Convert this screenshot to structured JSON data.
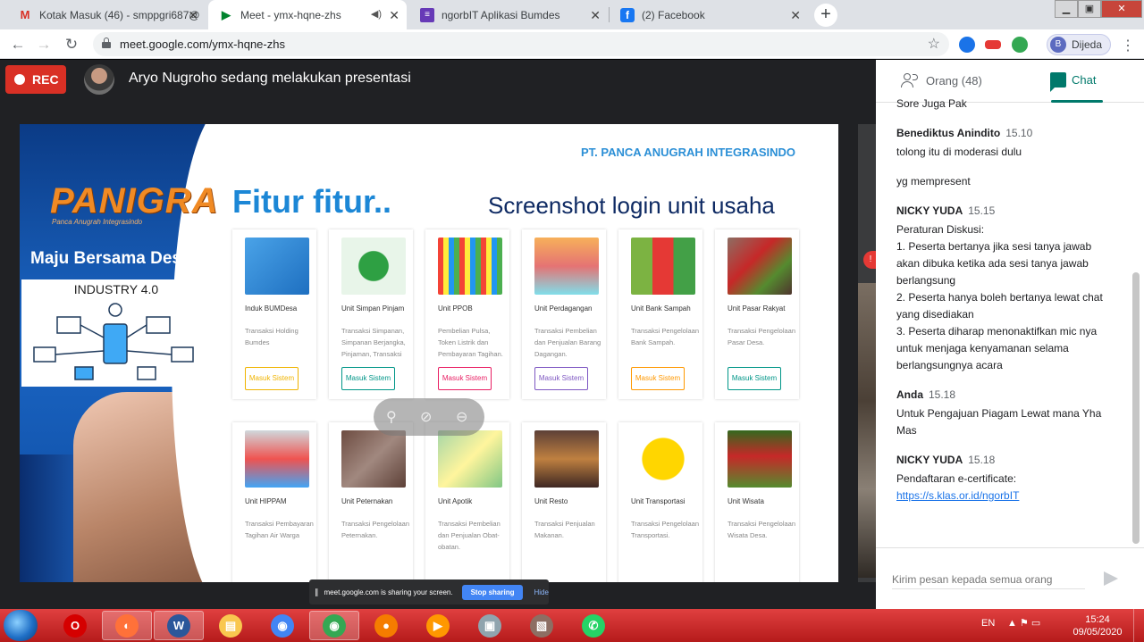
{
  "browser": {
    "tabs": [
      {
        "title": "Kotak Masuk (46) - smppgri687@",
        "icon": "gmail-icon",
        "color": "#d93025",
        "glyph": "M"
      },
      {
        "title": "Meet - ymx-hqne-zhs",
        "icon": "meet-icon",
        "color": "#00832d",
        "glyph": "▶"
      },
      {
        "title": "ngorbIT Aplikasi Bumdes",
        "icon": "form-icon",
        "color": "#673ab7",
        "glyph": "≡"
      },
      {
        "title": "(2) Facebook",
        "icon": "facebook-icon",
        "color": "#1877f2",
        "glyph": "f"
      }
    ],
    "new_tab": "+",
    "url": "meet.google.com/ymx-hqne-zhs",
    "profile_initial": "B",
    "profile_name": "Dijeda"
  },
  "meet": {
    "rec_label": "REC",
    "presenting_text": "Aryo Nugroho sedang melakukan presentasi",
    "sharing_text": "meet.google.com is sharing your screen.",
    "stop_sharing": "Stop sharing",
    "hide": "Hide"
  },
  "slide": {
    "logo": "PANIGRA",
    "logo_sub": "Panca Anugrah Integrasindo",
    "slogan": "Maju Bersama Desa",
    "industry": "INDUSTRY 4.0",
    "company": "PT. PANCA ANUGRAH INTEGRASINDO",
    "title_left": "Fitur fitur..",
    "title_right": "Screenshot  login unit usaha",
    "button_label": "Masuk Sistem",
    "cards": [
      {
        "name": "Induk BUMDesa",
        "desc": "Transaksi Holding Bumdes",
        "btn_color": "#f0b400",
        "img": "linear-gradient(135deg,#4aa3e8,#1e6fc0)"
      },
      {
        "name": "Unit Simpan Pinjam",
        "desc": "Transaksi Simpanan, Simpanan Berjangka, Pinjaman, Transaksi",
        "btn_color": "#009688",
        "img": "radial-gradient(circle,#2ea043 0 34%,#e8f5e9 36%)"
      },
      {
        "name": "Unit PPOB",
        "desc": "Pembelian Pulsa, Token Listrik dan Pembayaran Tagihan.",
        "btn_color": "#e91e63",
        "img": "repeating-linear-gradient(90deg,#f44336 0 6px,#ffeb3b 6px 12px,#2196f3 12px 18px,#4caf50 18px 24px)"
      },
      {
        "name": "Unit Perdagangan",
        "desc": "Transaksi Pembelian dan Penjualan Barang Dagangan.",
        "btn_color": "#7e57c2",
        "img": "linear-gradient(180deg,#f7b05a,#e57373 50%,#80deea)"
      },
      {
        "name": "Unit Bank Sampah",
        "desc": "Transaksi Pengelolaan Bank Sampah.",
        "btn_color": "#ff9800",
        "img": "linear-gradient(90deg,#7cb342 0 33%,#e53935 33% 66%,#43a047 66%)"
      },
      {
        "name": "Unit Pasar Rakyat",
        "desc": "Transaksi Pengelolaan Pasar Desa.",
        "btn_color": "#009688",
        "img": "linear-gradient(135deg,#8d6e63,#c62828 40%,#558b2f 70%,#4e342e)"
      },
      {
        "name": "Unit HIPPAM",
        "desc": "Transaksi Pembayaran Tagihan Air Warga",
        "btn_color": "",
        "img": "linear-gradient(180deg,#cfd8dc,#ef5350 50%,#42a5f5)"
      },
      {
        "name": "Unit Peternakan",
        "desc": "Transaksi Pengelolaan Peternakan.",
        "btn_color": "",
        "img": "linear-gradient(135deg,#6d4c41,#a1887f 50%,#5d4037)"
      },
      {
        "name": "Unit Apotik",
        "desc": "Transaksi Pembelian dan Penjualan Obat-obatan.",
        "btn_color": "",
        "img": "linear-gradient(135deg,#a5d6a7,#fff59d 50%,#81c784)"
      },
      {
        "name": "Unit Resto",
        "desc": "Transaksi Penjualan Makanan.",
        "btn_color": "",
        "img": "linear-gradient(180deg,#5d4037,#bf8040 50%,#3e2723)"
      },
      {
        "name": "Unit Transportasi",
        "desc": "Transaksi Pengelolaan Transportasi.",
        "btn_color": "",
        "img": "radial-gradient(circle,#ffd600 0 48%,#fff 50%)"
      },
      {
        "name": "Unit Wisata",
        "desc": "Transaksi Pengelolaan Wisata Desa.",
        "btn_color": "",
        "img": "linear-gradient(180deg,#33691e,#c62828 45%,#558b2f)"
      }
    ]
  },
  "panel": {
    "people_tab": "Orang (48)",
    "chat_tab": "Chat",
    "messages": [
      {
        "sender": "",
        "time": "",
        "lines": [
          "Sore Juga Pak"
        ]
      },
      {
        "sender": "Benediktus Anindito",
        "time": "15.10",
        "lines": [
          "tolong itu di moderasi dulu"
        ]
      },
      {
        "sender": "",
        "time": "",
        "lines": [
          "yg mempresent"
        ]
      },
      {
        "sender": "NICKY YUDA",
        "time": "15.15",
        "lines": [
          "Peraturan Diskusi:",
          "1. Peserta bertanya jika sesi tanya jawab",
          "akan dibuka ketika ada sesi tanya jawab",
          "berlangsung",
          "2. Peserta hanya boleh bertanya lewat chat",
          "yang disediakan",
          "3. Peserta diharap menonaktifkan mic nya",
          "untuk menjaga kenyamanan selama",
          "berlangsungnya acara"
        ]
      },
      {
        "sender": "Anda",
        "time": "15.18",
        "lines": [
          "Untuk Pengajuan Piagam Lewat mana Yha",
          "Mas"
        ]
      },
      {
        "sender": "NICKY YUDA",
        "time": "15.18",
        "lines": [
          "Pendaftaran e-certificate:"
        ],
        "link": "https://s.klas.or.id/ngorbIT"
      }
    ],
    "compose_placeholder": "Kirim pesan kepada semua orang"
  },
  "taskbar": {
    "apps": [
      {
        "name": "opera-icon",
        "color": "#d50000",
        "glyph": "O",
        "active": false
      },
      {
        "name": "firefox-icon",
        "color": "#ff7139",
        "glyph": "◐",
        "active": true
      },
      {
        "name": "word-icon",
        "color": "#2b579a",
        "glyph": "W",
        "active": true
      },
      {
        "name": "explorer-icon",
        "color": "#f9c74f",
        "glyph": "▤",
        "active": false
      },
      {
        "name": "chrome-icon",
        "color": "#4285f4",
        "glyph": "◉",
        "active": false
      },
      {
        "name": "chrome-profile-icon",
        "color": "#34a853",
        "glyph": "◉",
        "active": true
      },
      {
        "name": "avast-icon",
        "color": "#f57c00",
        "glyph": "●",
        "active": false
      },
      {
        "name": "media-player-icon",
        "color": "#ff9800",
        "glyph": "▶",
        "active": false
      },
      {
        "name": "network-icon",
        "color": "#90a4ae",
        "glyph": "▣",
        "active": false
      },
      {
        "name": "image-viewer-icon",
        "color": "#8d6e63",
        "glyph": "▧",
        "active": false
      },
      {
        "name": "whatsapp-icon",
        "color": "#25d366",
        "glyph": "✆",
        "active": false
      }
    ],
    "lang": "EN",
    "time": "15:24",
    "date": "09/05/2020"
  }
}
